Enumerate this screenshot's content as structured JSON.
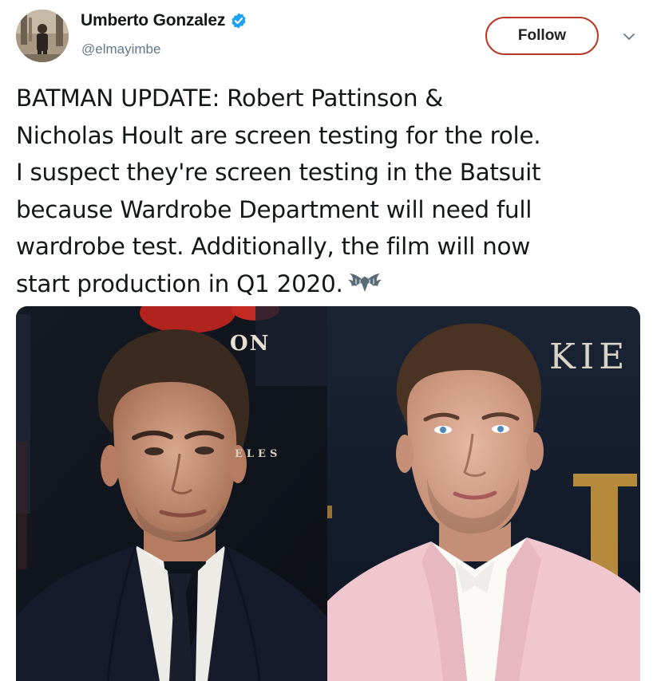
{
  "author": {
    "display_name": "Umberto Gonzalez",
    "handle": "@elmayimbe",
    "verified": true,
    "avatar_icon": "profile-photo"
  },
  "actions": {
    "follow_label": "Follow",
    "menu_icon": "chevron-down-icon"
  },
  "tweet": {
    "lines": [
      "BATMAN UPDATE: Robert Pattinson &",
      "Nicholas Hoult are screen testing for the role.",
      "I suspect they're screen testing in the Batsuit",
      "because Wardrobe Department will need full",
      "wardrobe test. Additionally, the film will now",
      "start production in Q1 2020."
    ],
    "emoji": "bat-emoji"
  },
  "media": {
    "left_photo": {
      "backdrop_texts": [
        "ON",
        "ELES"
      ]
    },
    "right_photo": {
      "backdrop_texts": [
        "KIE",
        "I"
      ]
    }
  },
  "colors": {
    "follow_border": "#b73a27",
    "verified_blue": "#1da1f2",
    "handle_gray": "#657786",
    "text": "#14171a"
  }
}
